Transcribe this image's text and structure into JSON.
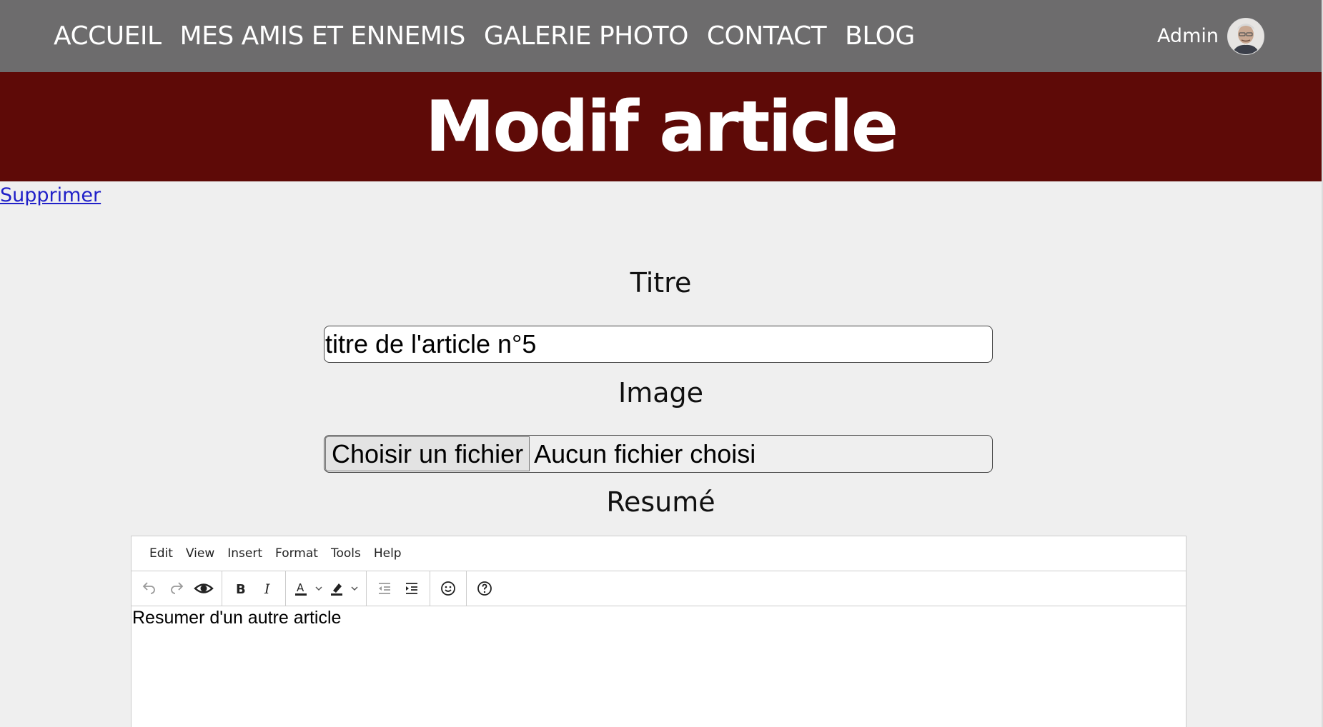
{
  "navbar": {
    "links": [
      "ACCUEIL",
      "MES AMIS ET ENNEMIS",
      "GALERIE PHOTO",
      "CONTACT",
      "BLOG"
    ],
    "user_name": "Admin",
    "background": "#6d6c6d"
  },
  "banner": {
    "title": "Modif article",
    "background": "#5e0a07"
  },
  "delete_link": "Supprimer",
  "form": {
    "title_label": "Titre",
    "title_value": "titre de l'article n°5",
    "image_label": "Image",
    "file_button": "Choisir un fichier",
    "file_status": "Aucun fichier choisi",
    "summary_label": "Resumé"
  },
  "editor": {
    "menu": [
      "Edit",
      "View",
      "Insert",
      "Format",
      "Tools",
      "Help"
    ],
    "toolbar_icons": [
      "undo-icon",
      "redo-icon",
      "preview-icon",
      "bold-icon",
      "italic-icon",
      "text-color-icon",
      "highlight-icon",
      "outdent-icon",
      "indent-icon",
      "emoticons-icon",
      "help-icon"
    ],
    "content": "Resumer d'un autre article"
  },
  "colors": {
    "page_background": "#efefef",
    "link": "#2020c8"
  }
}
